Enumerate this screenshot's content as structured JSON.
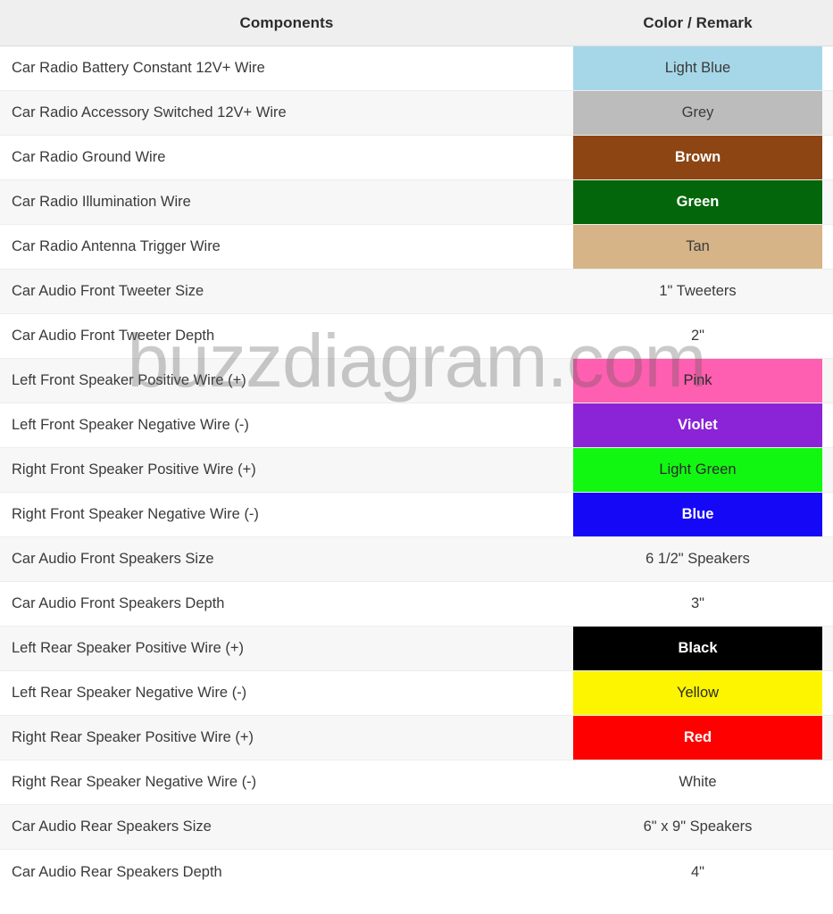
{
  "table": {
    "headers": {
      "components": "Components",
      "color_remark": "Color / Remark"
    },
    "rows": [
      {
        "component": "Car Radio Battery Constant 12V+ Wire",
        "value": "Light Blue",
        "bg": "#a6d7e8",
        "fg": "#3a3a3a"
      },
      {
        "component": "Car Radio Accessory Switched 12V+ Wire",
        "value": "Grey",
        "bg": "#bcbcbc",
        "fg": "#3a3a3a"
      },
      {
        "component": "Car Radio Ground Wire",
        "value": "Brown",
        "bg": "#8c4513",
        "fg": "#ffffff"
      },
      {
        "component": "Car Radio Illumination Wire",
        "value": "Green",
        "bg": "#04660a",
        "fg": "#ffffff"
      },
      {
        "component": "Car Radio Antenna Trigger Wire",
        "value": "Tan",
        "bg": "#d6b487",
        "fg": "#3a3a3a"
      },
      {
        "component": "Car Audio Front Tweeter Size",
        "value": "1\" Tweeters",
        "bg": null,
        "fg": "#3a3a3a"
      },
      {
        "component": "Car Audio Front Tweeter Depth",
        "value": "2\"",
        "bg": null,
        "fg": "#3a3a3a"
      },
      {
        "component": "Left Front Speaker Positive Wire (+)",
        "value": "Pink",
        "bg": "#ff5fb0",
        "fg": "#2b2b2b"
      },
      {
        "component": "Left Front Speaker Negative Wire (-)",
        "value": "Violet",
        "bg": "#8a24d6",
        "fg": "#ffffff"
      },
      {
        "component": "Right Front Speaker Positive Wire (+)",
        "value": "Light Green",
        "bg": "#12f712",
        "fg": "#2b2b2b"
      },
      {
        "component": "Right Front Speaker Negative Wire (-)",
        "value": "Blue",
        "bg": "#1508f7",
        "fg": "#ffffff"
      },
      {
        "component": "Car Audio Front Speakers Size",
        "value": "6 1/2\" Speakers",
        "bg": null,
        "fg": "#3a3a3a"
      },
      {
        "component": "Car Audio Front Speakers Depth",
        "value": "3\"",
        "bg": null,
        "fg": "#3a3a3a"
      },
      {
        "component": "Left Rear Speaker Positive Wire (+)",
        "value": "Black",
        "bg": "#000000",
        "fg": "#ffffff"
      },
      {
        "component": "Left Rear Speaker Negative Wire (-)",
        "value": "Yellow",
        "bg": "#fdf500",
        "fg": "#2b2b2b"
      },
      {
        "component": "Right Rear Speaker Positive Wire (+)",
        "value": "Red",
        "bg": "#fe0000",
        "fg": "#ffffff"
      },
      {
        "component": "Right Rear Speaker Negative Wire (-)",
        "value": "White",
        "bg": "#ffffff",
        "fg": "#3a3a3a"
      },
      {
        "component": "Car Audio Rear Speakers Size",
        "value": "6\" x 9\" Speakers",
        "bg": null,
        "fg": "#3a3a3a"
      },
      {
        "component": "Car Audio Rear Speakers Depth",
        "value": "4\"",
        "bg": null,
        "fg": "#3a3a3a"
      }
    ]
  },
  "watermark": {
    "text": "buzzdiagram.com"
  }
}
